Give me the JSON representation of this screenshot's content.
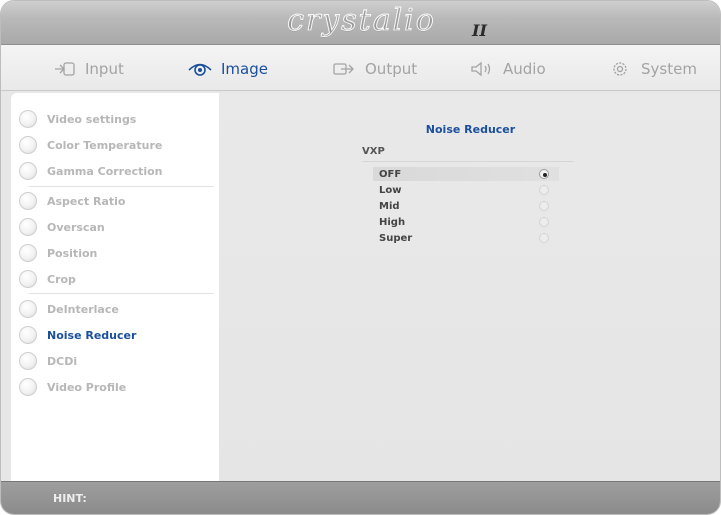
{
  "app": {
    "logo_text": "crystalio",
    "logo_suffix": "II"
  },
  "tabs": [
    {
      "label": "Input",
      "icon": "input-icon",
      "active": false
    },
    {
      "label": "Image",
      "icon": "eye-icon",
      "active": true
    },
    {
      "label": "Output",
      "icon": "output-icon",
      "active": false
    },
    {
      "label": "Audio",
      "icon": "speaker-icon",
      "active": false
    },
    {
      "label": "System",
      "icon": "gear-icon",
      "active": false
    }
  ],
  "sidebar": {
    "items": [
      {
        "label": "Video settings",
        "active": false
      },
      {
        "label": "Color Temperature",
        "active": false
      },
      {
        "label": "Gamma Correction",
        "active": false
      },
      {
        "label": "Aspect Ratio",
        "active": false
      },
      {
        "label": "Overscan",
        "active": false
      },
      {
        "label": "Position",
        "active": false
      },
      {
        "label": "Crop",
        "active": false
      },
      {
        "label": "DeInterlace",
        "active": false
      },
      {
        "label": "Noise Reducer",
        "active": true
      },
      {
        "label": "DCDi",
        "active": false
      },
      {
        "label": "Video Profile",
        "active": false
      }
    ]
  },
  "main": {
    "title": "Noise Reducer",
    "group": "VXP",
    "options": [
      {
        "label": "OFF",
        "selected": true
      },
      {
        "label": "Low",
        "selected": false
      },
      {
        "label": "Mid",
        "selected": false
      },
      {
        "label": "High",
        "selected": false
      },
      {
        "label": "Super",
        "selected": false
      }
    ]
  },
  "hint": {
    "label": "HINT:"
  },
  "colors": {
    "accent": "#1a4f9c",
    "inactive_text": "#b7b7b7"
  }
}
